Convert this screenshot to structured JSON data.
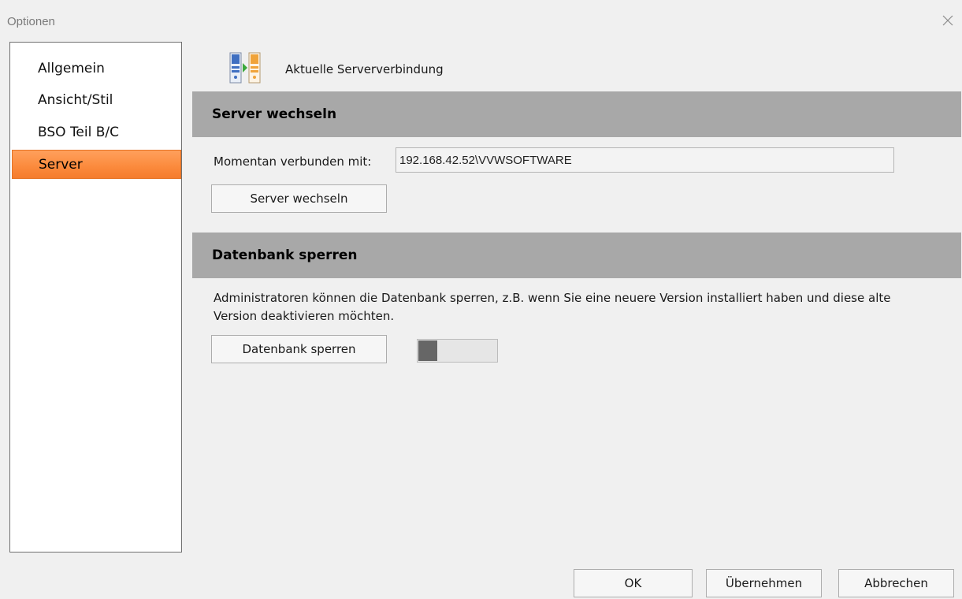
{
  "window": {
    "title": "Optionen"
  },
  "sidebar": {
    "items": [
      {
        "label": "Allgemein",
        "active": false
      },
      {
        "label": "Ansicht/Stil",
        "active": false
      },
      {
        "label": "BSO Teil B/C",
        "active": false
      },
      {
        "label": "Server",
        "active": true
      }
    ]
  },
  "connection": {
    "icon": "server-switch-icon",
    "label": "Aktuelle Serververbindung"
  },
  "server_section": {
    "heading": "Server wechseln",
    "connected_label": "Momentan verbunden mit:",
    "connected_value": "192.168.42.52\\VVWSOFTWARE",
    "button_label": "Server wechseln"
  },
  "db_section": {
    "heading": "Datenbank sperren",
    "description": "Administratoren können die Datenbank sperren, z.B. wenn Sie eine neuere Version installiert haben und diese alte Version deaktivieren möchten.",
    "button_label": "Datenbank sperren",
    "toggle_state": "off"
  },
  "footer": {
    "ok_label": "OK",
    "apply_label": "Übernehmen",
    "cancel_label": "Abbrechen"
  },
  "colors": {
    "accent": "#fb8a3c",
    "section_bar": "#a8a8a8"
  }
}
